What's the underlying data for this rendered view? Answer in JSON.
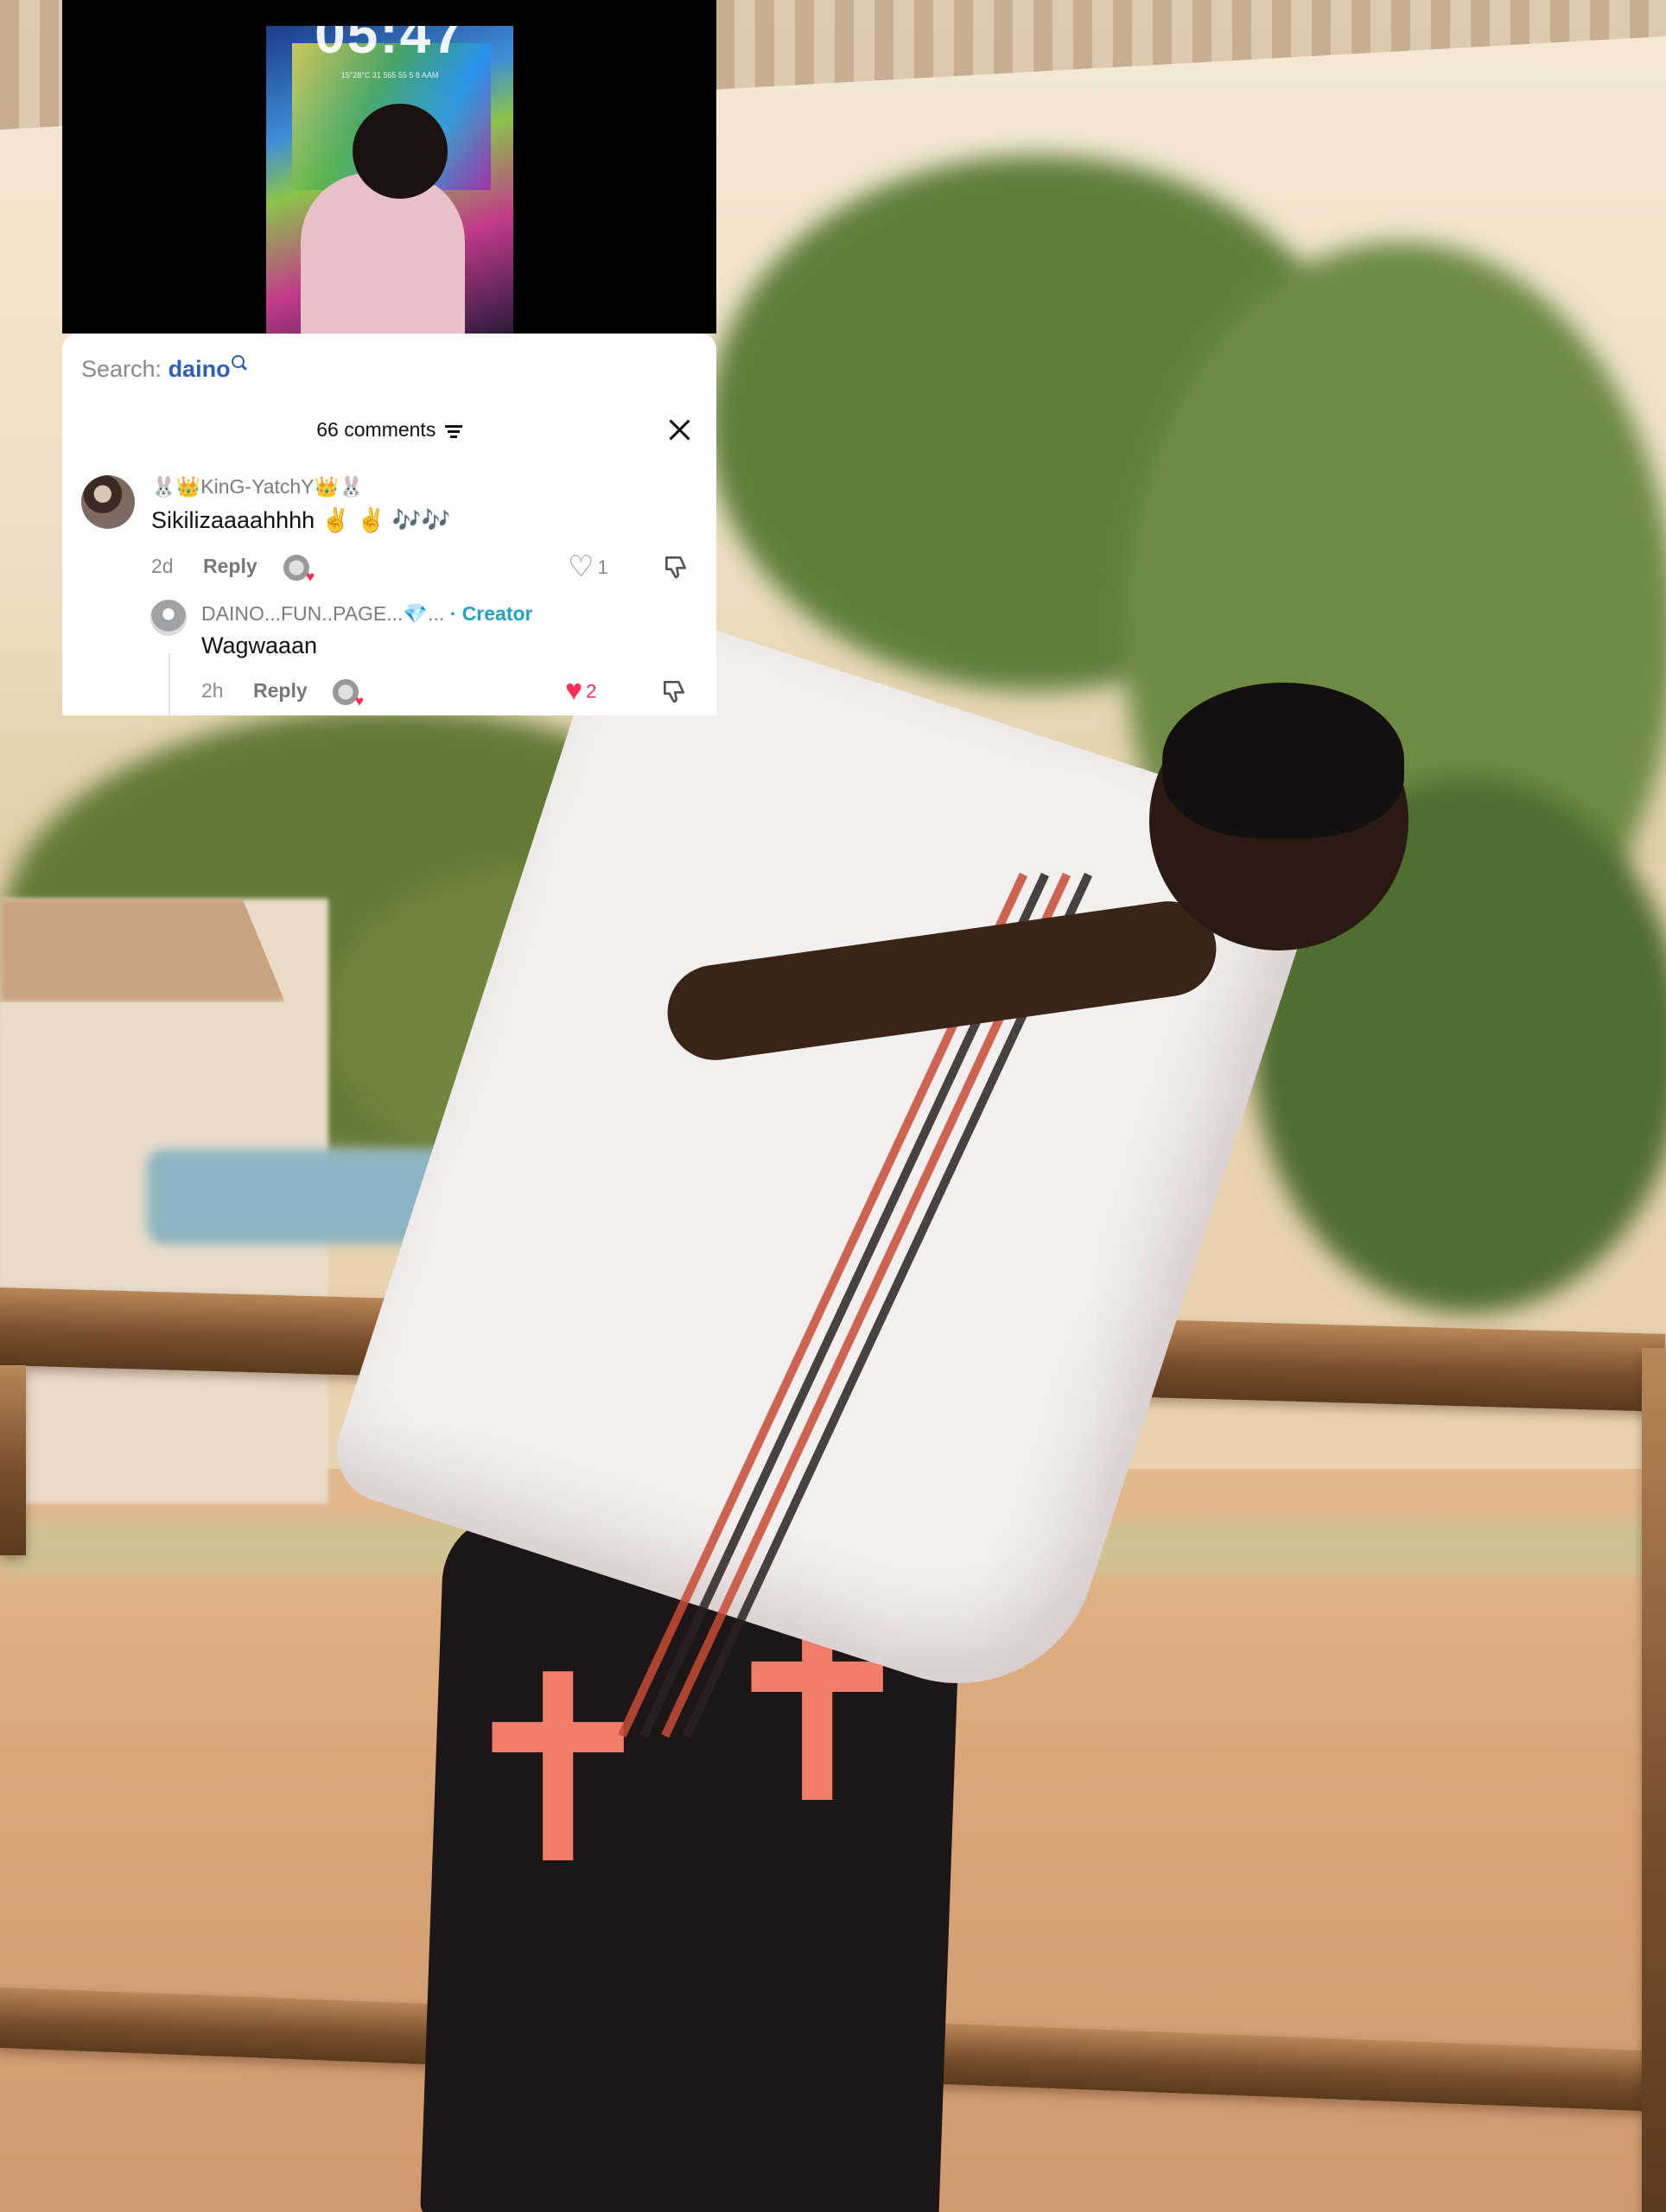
{
  "video": {
    "clock": "05:47",
    "status_line": "15°28°C 31 565 55 5 8 AAM"
  },
  "comments_panel": {
    "search_label": "Search: ",
    "search_keyword": "daino",
    "comment_count": "66 comments",
    "comments": [
      {
        "username": "🐰👑KinG-YatchY👑🐰",
        "text": "Sikilizaaaahhhh ✌️ ✌️ 🎶🎶",
        "age": "2d",
        "reply_label": "Reply",
        "likes": "1",
        "liked": false
      },
      {
        "username": "DAINO...FUN..PAGE...💎...",
        "badge": "· Creator",
        "text": "Wagwaaan",
        "age": "2h",
        "reply_label": "Reply",
        "likes": "2",
        "liked": true
      }
    ]
  },
  "colors": {
    "accent_creator": "#20a3c4",
    "search_keyword": "#2d5fb8",
    "liked_heart": "#fe2c55"
  }
}
